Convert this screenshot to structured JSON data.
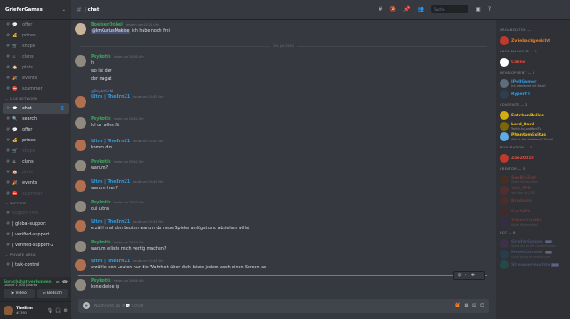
{
  "server": {
    "name": "GrieferGames"
  },
  "channels": [
    {
      "emoji": "💬",
      "label": "| offer",
      "state": "normal"
    },
    {
      "emoji": "💰",
      "label": "| prices",
      "state": "normal"
    },
    {
      "emoji": "🛒",
      "label": "| shops",
      "state": "normal"
    },
    {
      "emoji": "⚔",
      "label": "| clans",
      "state": "normal"
    },
    {
      "emoji": "🏠",
      "label": "| plots",
      "state": "normal"
    },
    {
      "emoji": "🎉",
      "label": "| events",
      "state": "normal"
    },
    {
      "emoji": "⛔",
      "label": "| scammer",
      "state": "normal"
    }
  ],
  "category_network": "1.16 NETWORK",
  "channels2": [
    {
      "emoji": "💬",
      "label": "| chat",
      "state": "sel"
    },
    {
      "emoji": "🔍",
      "label": "| search",
      "state": "bright"
    },
    {
      "emoji": "💬",
      "label": "| offer",
      "state": "bright"
    },
    {
      "emoji": "💰",
      "label": "| prices",
      "state": "bright"
    },
    {
      "emoji": "🛒",
      "label": "| shops",
      "state": "muted"
    },
    {
      "emoji": "⚔",
      "label": "| clans",
      "state": "bright"
    },
    {
      "emoji": "🏠",
      "label": "| plots",
      "state": "muted"
    },
    {
      "emoji": "🎉",
      "label": "| events",
      "state": "bright"
    },
    {
      "emoji": "⛔",
      "label": "| scammer",
      "state": "muted"
    }
  ],
  "category_support": "SUPPORT",
  "channels3": [
    {
      "emoji": "",
      "label": "support-info",
      "state": "muted"
    },
    {
      "emoji": "",
      "label": "| global-support",
      "state": "bright"
    },
    {
      "emoji": "",
      "label": "| verified-support",
      "state": "bright"
    },
    {
      "emoji": "",
      "label": "| verified-support-2",
      "state": "bright"
    }
  ],
  "category_private": "PRIVATE AREA",
  "channels4": [
    {
      "emoji": "",
      "label": "| talk-control",
      "state": "bright"
    }
  ],
  "voice": {
    "status": "Sprachchat verbunden",
    "channel": "Lounge 1 / GG Jakarta",
    "video_label": "Video",
    "screen_label": "Bildschi"
  },
  "user": {
    "name": "TheErm",
    "tag": "#1391"
  },
  "topbar": {
    "channel": "| chat",
    "search_placeholder": "Suche"
  },
  "messages": [
    {
      "author": "BoeiserOnkel",
      "author_color": "#3ba55d",
      "avatar_color": "#c9b39a",
      "time": "gestern um 15:28 Uhr",
      "lines": [
        {
          "mention": "@ImKuriusMakise",
          "text": " ich habe noch frei"
        }
      ]
    },
    {
      "date": "25. Juli 2020"
    },
    {
      "author": "Psykotis",
      "author_color": "#3ba55d",
      "avatar_color": "#8f8a7d",
      "time": "heute um 20:30 Uhr",
      "lines": [
        {
          "text": "hi"
        },
        {
          "text": "wo ist der"
        },
        {
          "text": "der nagat"
        }
      ]
    },
    {
      "reply_name": "@Psykotis",
      "reply_text": "hi",
      "author": "Ultra | TheErn21",
      "author_color": "#3498db",
      "avatar_color": "#b07050",
      "time": "heute um 20:42 Uhr",
      "lines": []
    },
    {
      "author": "Psykotis",
      "author_color": "#3ba55d",
      "avatar_color": "#8f8a7d",
      "time": "heute um 20:42 Uhr",
      "lines": [
        {
          "text": "lol un alles fit"
        }
      ]
    },
    {
      "author": "Ultra | TheErn21",
      "author_color": "#3498db",
      "avatar_color": "#b07050",
      "time": "heute um 20:42 Uhr",
      "lines": [
        {
          "text": "komm dm"
        }
      ]
    },
    {
      "author": "Psykotis",
      "author_color": "#3ba55d",
      "avatar_color": "#8f8a7d",
      "time": "heute um 20:42 Uhr",
      "lines": [
        {
          "text": "warum?"
        }
      ]
    },
    {
      "author": "Ultra | TheErn21",
      "author_color": "#3498db",
      "avatar_color": "#b07050",
      "time": "heute um 20:42 Uhr",
      "lines": [
        {
          "text": "warum hier?"
        }
      ]
    },
    {
      "author": "Psykotis",
      "author_color": "#3ba55d",
      "avatar_color": "#8f8a7d",
      "time": "heute um 20:43 Uhr",
      "lines": [
        {
          "text": "oui ultra"
        }
      ]
    },
    {
      "author": "Ultra | TheErn21",
      "author_color": "#3498db",
      "avatar_color": "#b07050",
      "time": "heute um 20:43 Uhr",
      "lines": [
        {
          "text": "erzähl mal den Leuten warum du neue Spieler anlügst und abziehen willst"
        }
      ]
    },
    {
      "author": "Psykotis",
      "author_color": "#3ba55d",
      "avatar_color": "#8f8a7d",
      "time": "heute um 20:43 Uhr",
      "lines": [
        {
          "text": "warum elliste mich vertig machen?"
        }
      ]
    },
    {
      "author": "Ultra | TheErn21",
      "author_color": "#3498db",
      "avatar_color": "#b07050",
      "time": "heute um 20:44 Uhr",
      "lines": [
        {
          "text": "erzähle den Leuten nur die Wahrheit über dich, biete jedem auch einen Screen an"
        }
      ]
    },
    {
      "author": "Psykotis",
      "author_color": "#3ba55d",
      "avatar_color": "#8f8a7d",
      "time": "heute um 20:44 Uhr",
      "lines": [
        {
          "text": "kene deine ip"
        }
      ]
    }
  ],
  "composer": {
    "placeholder": "Nachricht an #💬 | chat"
  },
  "members": [
    {
      "category": "ORGANISATOR — 1"
    },
    {
      "name": "Zwiebackgesicht",
      "color": "#e67e22",
      "avatar": "#c0392b",
      "status": ""
    },
    {
      "category": "SHOP-MANAGER — 1"
    },
    {
      "name": "Caline",
      "color": "#e74c3c",
      "avatar": "#ffffff",
      "status": ""
    },
    {
      "category": "DEVELOPMENT — 2"
    },
    {
      "name": "IPellGamer",
      "color": "#3498db",
      "avatar": "#5d6d7e",
      "status": "Ich arbeit ned mit Sand!"
    },
    {
      "name": "RyperYT",
      "color": "#3498db",
      "avatar": "#2c3e50",
      "status": ""
    },
    {
      "category": "CONTENTS — 3"
    },
    {
      "name": "EntchenBuilds",
      "color": "#f1c40f",
      "avatar": "#d4ac0d",
      "status": ""
    },
    {
      "name": "Lord_Bard",
      "color": "#f1c40f",
      "avatar": "#7d6608",
      "status": "Twitch.tv/LordBardTV"
    },
    {
      "name": "PhantomExitus",
      "color": "#f1c40f",
      "avatar": "#5dade2",
      "status": "Ahh, is this the blood? This bl..."
    },
    {
      "category": "MODERATION — 1"
    },
    {
      "name": "Zoe20010",
      "color": "#e74c3c",
      "avatar": "#c0392b",
      "status": ""
    },
    {
      "category": "CREATOR — 5"
    },
    {
      "name": "SeeBinZeit",
      "color": "#e74c3c",
      "avatar": "#6e2c00",
      "status": "Spielt MysteryMod",
      "faded": true
    },
    {
      "name": "Yeti_FFS",
      "color": "#e74c3c",
      "avatar": "#922b21",
      "status": "YouTube Yeti_FFS",
      "faded": true
    },
    {
      "name": "Bradspin",
      "color": "#e74c3c",
      "avatar": "#7b241c",
      "status": "",
      "faded": true
    },
    {
      "name": "SeeYaPL",
      "color": "#e74c3c",
      "avatar": "#641e16",
      "status": "",
      "faded": true
    },
    {
      "name": "ThiImPrindEn",
      "color": "#e74c3c",
      "avatar": "#4a235a",
      "status": "Spielt MysteryMod",
      "faded": true
    },
    {
      "category": "BOT — 6"
    },
    {
      "name": "GrieferGames",
      "color": "#7289da",
      "avatar": "#5b2c6f",
      "status": "Spielt Join to Die GrieferGames",
      "bot": "BOT",
      "faded": true
    },
    {
      "name": "ModeKammer",
      "color": "#7289da",
      "avatar": "#1a5276",
      "status": "Spielt going to emdied.com",
      "bot": "BOT",
      "faded": true
    },
    {
      "name": "Streamerleuchte",
      "color": "#7289da",
      "avatar": "#117864",
      "status": "",
      "bot": "BOT",
      "faded": true
    }
  ]
}
